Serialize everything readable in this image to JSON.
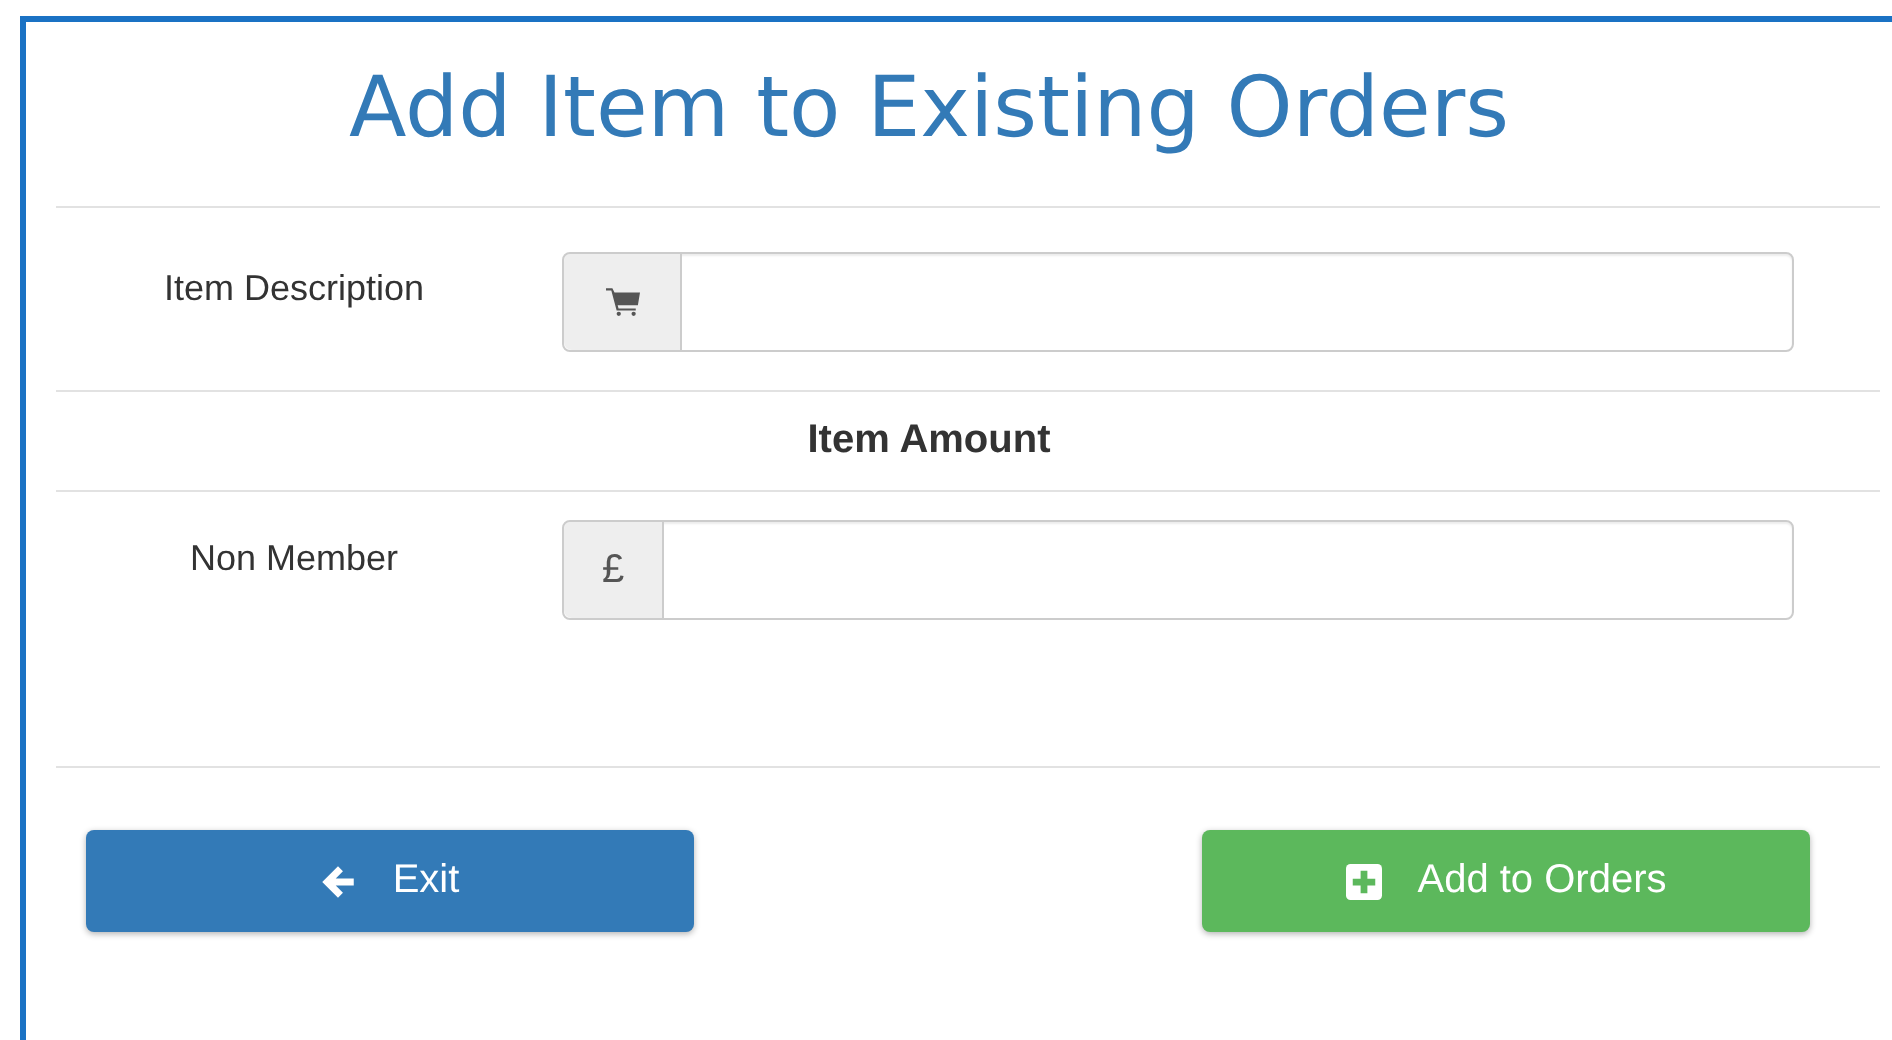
{
  "title": "Add Item to Existing Orders",
  "fields": [
    {
      "label": "Item Description",
      "addon": {
        "kind": "cart"
      }
    },
    {
      "label": "Non Member",
      "addon": {
        "kind": "text",
        "text": "£"
      }
    }
  ],
  "section_heading": "Item Amount",
  "buttons": [
    {
      "label": "Exit",
      "kind": "back"
    },
    {
      "label": "Add to Orders",
      "kind": "add"
    }
  ]
}
